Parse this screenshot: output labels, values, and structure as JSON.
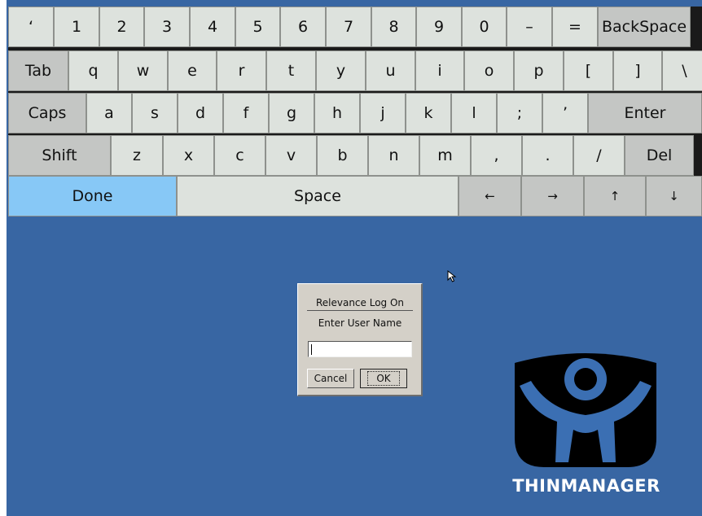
{
  "keyboard": {
    "rows": [
      [
        {
          "label": "‘",
          "style": "key",
          "w": 56
        },
        {
          "label": "1",
          "style": "key",
          "w": 56
        },
        {
          "label": "2",
          "style": "key",
          "w": 55
        },
        {
          "label": "3",
          "style": "key",
          "w": 56
        },
        {
          "label": "4",
          "style": "key",
          "w": 56
        },
        {
          "label": "5",
          "style": "key",
          "w": 55
        },
        {
          "label": "6",
          "style": "key",
          "w": 56
        },
        {
          "label": "7",
          "style": "key",
          "w": 56
        },
        {
          "label": "8",
          "style": "key",
          "w": 55
        },
        {
          "label": "9",
          "style": "key",
          "w": 56
        },
        {
          "label": "0",
          "style": "key",
          "w": 55
        },
        {
          "label": "–",
          "style": "key",
          "w": 56
        },
        {
          "label": "=",
          "style": "key",
          "w": 56
        },
        {
          "label": "BackSpace",
          "style": "mod",
          "w": 114
        }
      ],
      [
        {
          "label": "Tab",
          "style": "mod",
          "w": 74
        },
        {
          "label": "q",
          "style": "key",
          "w": 61
        },
        {
          "label": "w",
          "style": "key",
          "w": 61
        },
        {
          "label": "e",
          "style": "key",
          "w": 60
        },
        {
          "label": "r",
          "style": "key",
          "w": 61
        },
        {
          "label": "t",
          "style": "key",
          "w": 61
        },
        {
          "label": "y",
          "style": "key",
          "w": 61
        },
        {
          "label": "u",
          "style": "key",
          "w": 61
        },
        {
          "label": "i",
          "style": "key",
          "w": 60
        },
        {
          "label": "o",
          "style": "key",
          "w": 61
        },
        {
          "label": "p",
          "style": "key",
          "w": 61
        },
        {
          "label": "[",
          "style": "key",
          "w": 61
        },
        {
          "label": "]",
          "style": "key",
          "w": 60
        },
        {
          "label": "\\",
          "style": "key",
          "w": 55
        }
      ],
      [
        {
          "label": "Caps",
          "style": "mod",
          "w": 96
        },
        {
          "label": "a",
          "style": "key",
          "w": 56
        },
        {
          "label": "s",
          "style": "key",
          "w": 56
        },
        {
          "label": "d",
          "style": "key",
          "w": 56
        },
        {
          "label": "f",
          "style": "key",
          "w": 56
        },
        {
          "label": "g",
          "style": "key",
          "w": 56
        },
        {
          "label": "h",
          "style": "key",
          "w": 56
        },
        {
          "label": "j",
          "style": "key",
          "w": 56
        },
        {
          "label": "k",
          "style": "key",
          "w": 56
        },
        {
          "label": "l",
          "style": "key",
          "w": 56
        },
        {
          "label": ";",
          "style": "key",
          "w": 56
        },
        {
          "label": "’",
          "style": "key",
          "w": 56
        },
        {
          "label": "Enter",
          "style": "mod",
          "w": 140
        }
      ],
      [
        {
          "label": "Shift",
          "style": "mod",
          "w": 126
        },
        {
          "label": "z",
          "style": "key",
          "w": 64
        },
        {
          "label": "x",
          "style": "key",
          "w": 63
        },
        {
          "label": "c",
          "style": "key",
          "w": 63
        },
        {
          "label": "v",
          "style": "key",
          "w": 63
        },
        {
          "label": "b",
          "style": "key",
          "w": 63
        },
        {
          "label": "n",
          "style": "key",
          "w": 63
        },
        {
          "label": "m",
          "style": "key",
          "w": 63
        },
        {
          "label": ",",
          "style": "key",
          "w": 63
        },
        {
          "label": ".",
          "style": "key",
          "w": 63
        },
        {
          "label": "/",
          "style": "key",
          "w": 63
        },
        {
          "label": "Del",
          "style": "mod",
          "w": 85
        }
      ],
      [
        {
          "label": "Done",
          "style": "done",
          "w": 207
        },
        {
          "label": "Space",
          "style": "key",
          "w": 346
        },
        {
          "label": "←",
          "style": "mod small",
          "w": 77
        },
        {
          "label": "→",
          "style": "mod small",
          "w": 77
        },
        {
          "label": "↑",
          "style": "mod small",
          "w": 76
        },
        {
          "label": "↓",
          "style": "mod small",
          "w": 69
        }
      ]
    ]
  },
  "dialog": {
    "title": "Relevance Log On",
    "prompt": "Enter User Name",
    "input_value": "",
    "cancel_label": "Cancel",
    "ok_label": "OK"
  },
  "branding": {
    "name": "THINMANAGER",
    "icon": "thinmanager-logo-icon",
    "color": "#000000"
  },
  "colors": {
    "desktop": "#3866a3",
    "key": "#dde2dd",
    "modifier_key": "#c4c6c4",
    "done_key": "#87c8f6"
  }
}
